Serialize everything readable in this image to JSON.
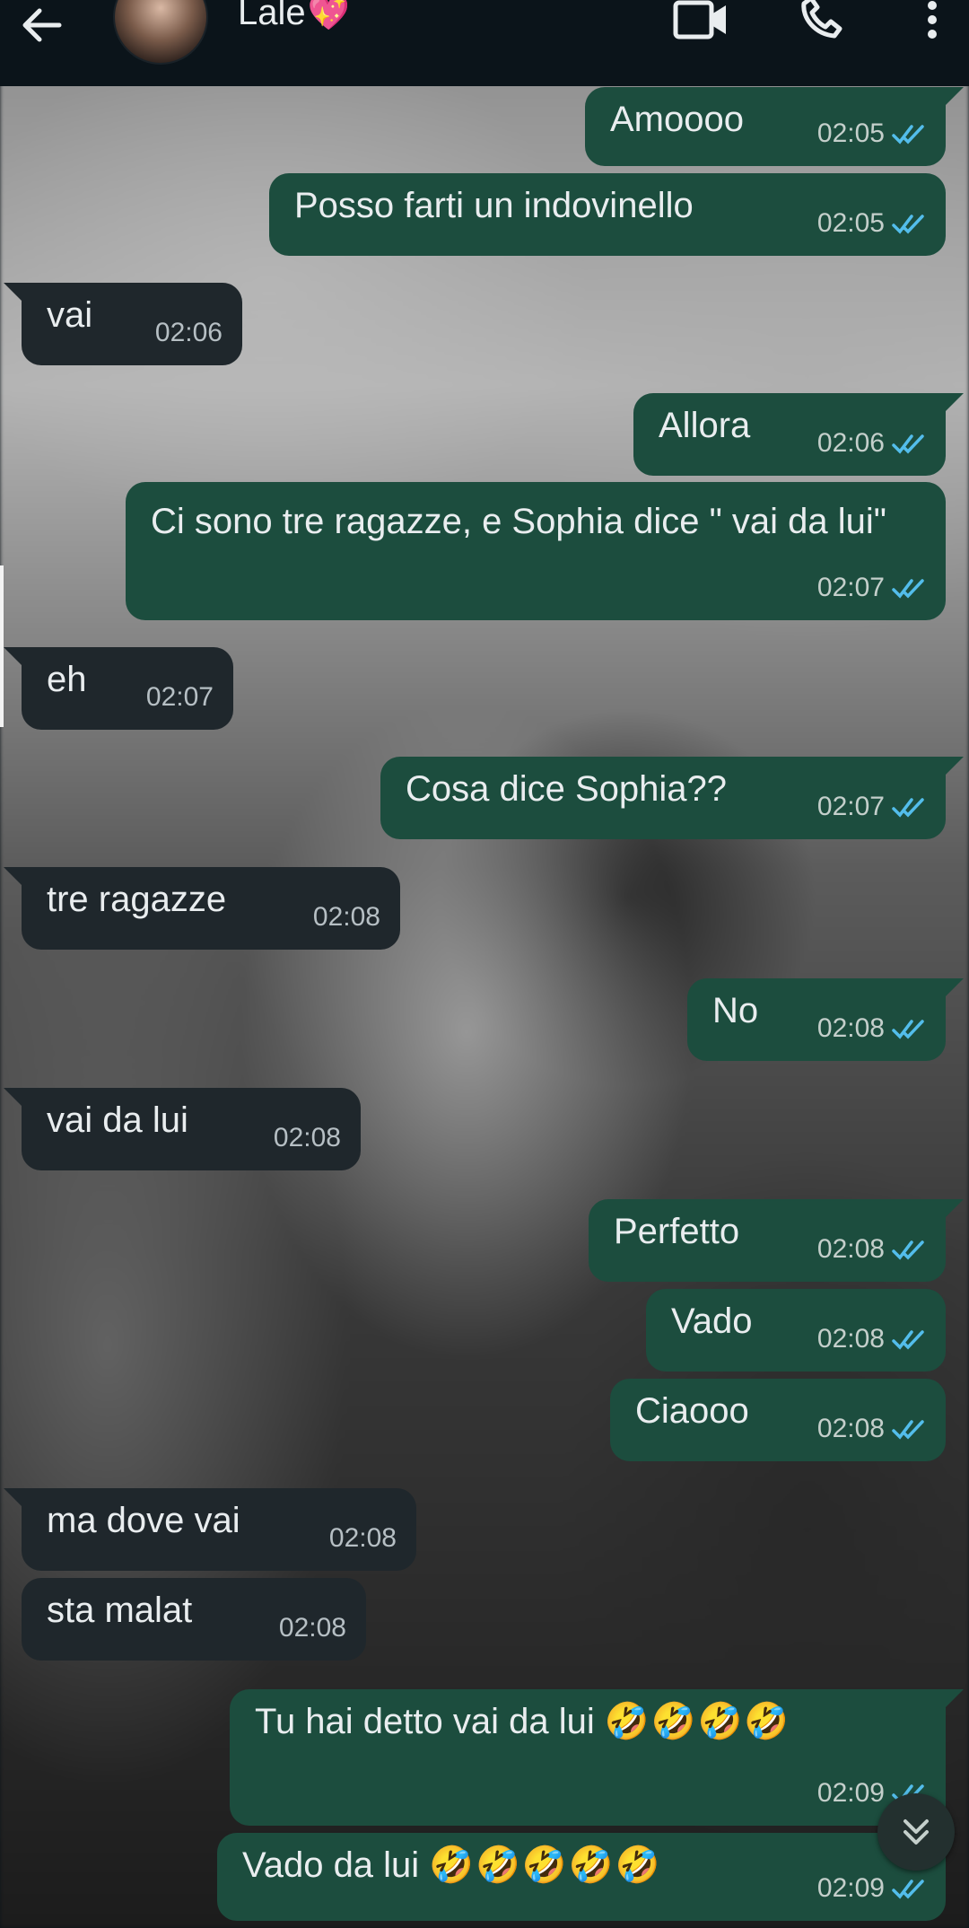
{
  "header": {
    "contact_name": "Lale",
    "heart_emoji": "💖"
  },
  "messages": [
    {
      "dir": "out",
      "text": "Amoooo",
      "time": "02:05"
    },
    {
      "dir": "out",
      "text": "Posso farti un indovinello",
      "time": "02:05"
    },
    {
      "dir": "in",
      "text": "vai",
      "time": "02:06"
    },
    {
      "dir": "out",
      "text": "Allora",
      "time": "02:06"
    },
    {
      "dir": "out",
      "text": "Ci sono tre ragazze, e Sophia dice \" vai da lui\"",
      "time": "02:07"
    },
    {
      "dir": "in",
      "text": "eh",
      "time": "02:07"
    },
    {
      "dir": "out",
      "text": "Cosa dice Sophia??",
      "time": "02:07"
    },
    {
      "dir": "in",
      "text": "tre ragazze",
      "time": "02:08"
    },
    {
      "dir": "out",
      "text": "No",
      "time": "02:08"
    },
    {
      "dir": "in",
      "text": "vai da lui",
      "time": "02:08"
    },
    {
      "dir": "out",
      "text": "Perfetto",
      "time": "02:08"
    },
    {
      "dir": "out",
      "text": "Vado",
      "time": "02:08"
    },
    {
      "dir": "out",
      "text": "Ciaooo",
      "time": "02:08"
    },
    {
      "dir": "in",
      "text": "ma dove vai",
      "time": "02:08"
    },
    {
      "dir": "in",
      "text": "sta malat",
      "time": "02:08"
    },
    {
      "dir": "out",
      "text": "Tu hai detto vai da lui",
      "emoji": "🤣🤣🤣🤣",
      "time": "02:09"
    },
    {
      "dir": "out",
      "text": "Vado da lui",
      "emoji": "🤣🤣🤣🤣🤣",
      "time": "02:09"
    }
  ],
  "colors": {
    "outgoing_bubble": "#1c4d3e",
    "incoming_bubble": "#1f272c",
    "read_ticks": "#53bdeb"
  }
}
